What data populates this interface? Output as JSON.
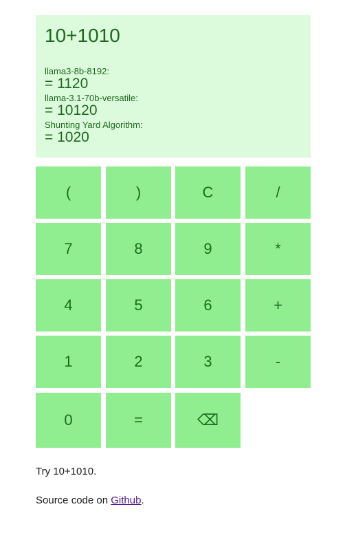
{
  "display": {
    "expression": "10+1010",
    "results": [
      {
        "model": "llama3-8b-8192:",
        "answer": "= 1120"
      },
      {
        "model": "llama-3.1-70b-versatile:",
        "answer": "= 10120"
      },
      {
        "model": "Shunting Yard Algorithm:",
        "answer": "= 1020"
      }
    ]
  },
  "keys": {
    "open_paren": "(",
    "close_paren": ")",
    "clear": "C",
    "divide": "/",
    "seven": "7",
    "eight": "8",
    "nine": "9",
    "multiply": "*",
    "four": "4",
    "five": "5",
    "six": "6",
    "plus": "+",
    "one": "1",
    "two": "2",
    "three": "3",
    "minus": "-",
    "zero": "0",
    "equals": "=",
    "backspace": "⌫"
  },
  "footer": {
    "try_text": "Try 10+1010.",
    "source_prefix": "Source code on ",
    "source_link": "Github",
    "source_suffix": "."
  },
  "colors": {
    "display_bg": "#dcfadc",
    "key_bg": "#90ee90",
    "text": "#1d6a1d",
    "link": "#551a8b"
  }
}
